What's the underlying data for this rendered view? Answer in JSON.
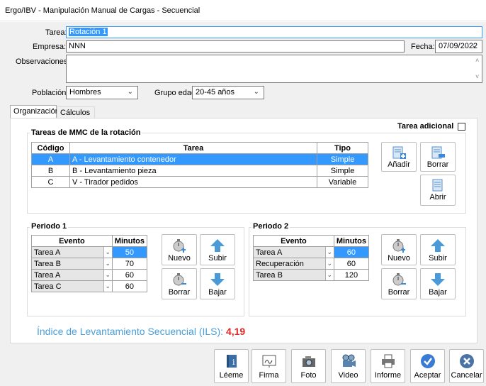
{
  "window": {
    "title": "Ergo/IBV - Manipulación Manual de Cargas - Secuencial"
  },
  "form": {
    "tarea_label": "Tarea:",
    "tarea_value": "Rotación 1",
    "empresa_label": "Empresa:",
    "empresa_value": "NNN",
    "fecha_label": "Fecha:",
    "fecha_value": "07/09/2022",
    "observaciones_label": "Observaciones:",
    "observaciones_value": "",
    "poblacion_label": "Población:",
    "poblacion_value": "Hombres",
    "grupo_edad_label": "Grupo edad",
    "grupo_edad_value": "20-45 años"
  },
  "tabs": [
    {
      "label": "Organización",
      "active": true
    },
    {
      "label": "Cálculos",
      "active": false
    }
  ],
  "tareas_mmc": {
    "title": "Tareas de MMC de la rotación",
    "tarea_adicional_label": "Tarea adicional",
    "tarea_adicional_checked": false,
    "headers": [
      "Código",
      "Tarea",
      "Tipo"
    ],
    "rows": [
      {
        "codigo": "A",
        "tarea": "A - Levantamiento contenedor",
        "tipo": "Simple",
        "selected": true
      },
      {
        "codigo": "B",
        "tarea": "B - Levantamiento pieza",
        "tipo": "Simple",
        "selected": false
      },
      {
        "codigo": "C",
        "tarea": "V - Tirador pedidos",
        "tipo": "Variable",
        "selected": false
      }
    ],
    "buttons": {
      "anadir": "Añadir",
      "borrar": "Borrar",
      "abrir": "Abrir"
    }
  },
  "periodo1": {
    "title": "Periodo 1",
    "headers": [
      "Evento",
      "Minutos"
    ],
    "rows": [
      {
        "evento": "Tarea A",
        "minutos": "50"
      },
      {
        "evento": "Tarea B",
        "minutos": "70"
      },
      {
        "evento": "Tarea A",
        "minutos": "60"
      },
      {
        "evento": "Tarea C",
        "minutos": "60"
      }
    ],
    "buttons": {
      "nuevo": "Nuevo",
      "subir": "Subir",
      "borrar": "Borrar",
      "bajar": "Bajar"
    }
  },
  "periodo2": {
    "title": "Periodo 2",
    "headers": [
      "Evento",
      "Minutos"
    ],
    "rows": [
      {
        "evento": "Tarea A",
        "minutos": "60"
      },
      {
        "evento": "Recuperación",
        "minutos": "60"
      },
      {
        "evento": "Tarea B",
        "minutos": "120"
      }
    ],
    "buttons": {
      "nuevo": "Nuevo",
      "subir": "Subir",
      "borrar": "Borrar",
      "bajar": "Bajar"
    }
  },
  "ils": {
    "label": "Índice de Levantamiento Secuencial (ILS):",
    "value": "4,19"
  },
  "footer": {
    "leeme": "Léeme",
    "firma": "Firma",
    "foto": "Foto",
    "video": "Video",
    "informe": "Informe",
    "aceptar": "Aceptar",
    "cancelar": "Cancelar"
  },
  "colors": {
    "accent": "#3399ff",
    "ils_label": "#4a9fd8",
    "ils_value": "#e32626",
    "ok": "#3a7bd5",
    "cancel": "#4a74a8"
  }
}
